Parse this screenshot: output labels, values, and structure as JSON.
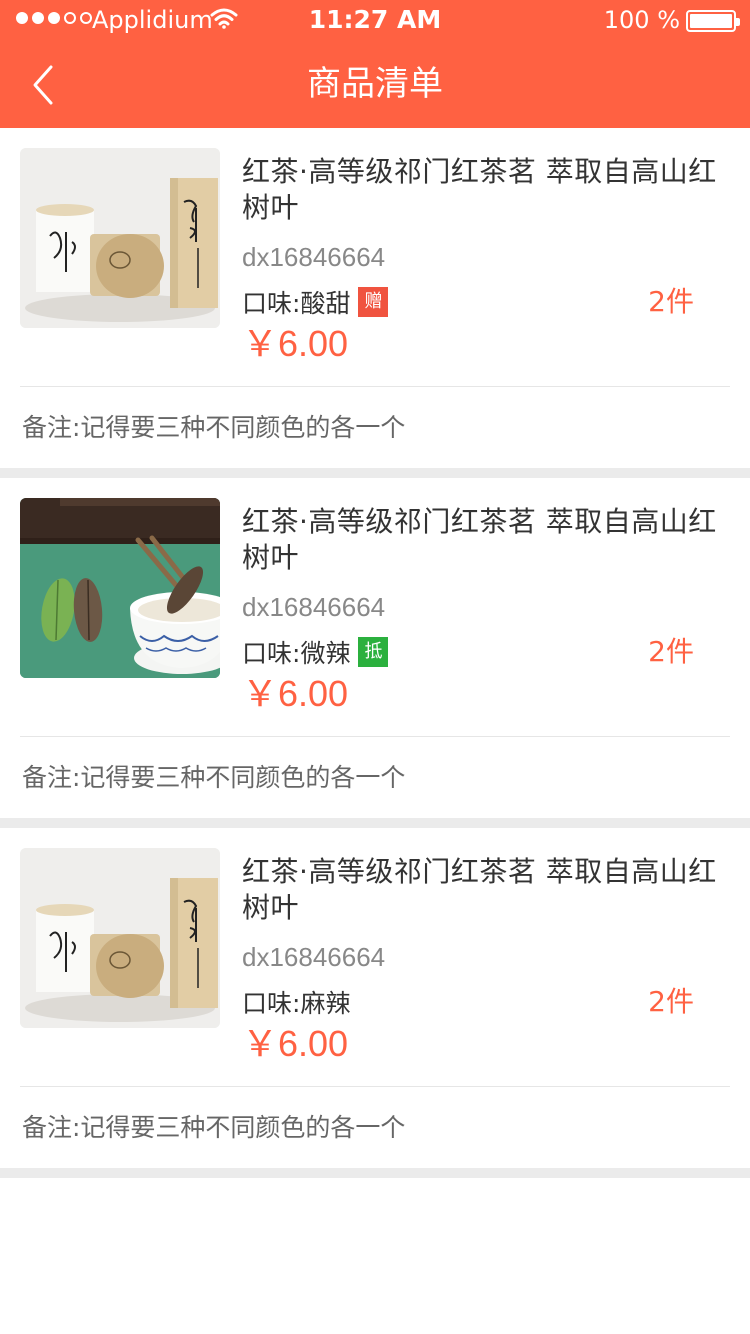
{
  "status_bar": {
    "carrier": "Applidium",
    "time": "11:27 AM",
    "battery": "100 %",
    "signal_strength": 3,
    "signal_total": 5,
    "battery_level": 1.0,
    "wifi_icon": "wifi-icon"
  },
  "nav": {
    "title": "商品清单",
    "back_icon": "chevron-left-icon"
  },
  "colors": {
    "accent": "#ff6142",
    "tag_gift": "#f0533f",
    "tag_credit": "#2bb03e"
  },
  "products": [
    {
      "title": "红茶·高等级祁门红茶茗  萃取自高山红树叶",
      "code": "dx16846664",
      "flavor_label": "口味:",
      "flavor_value": "酸甜",
      "tag": "赠",
      "tag_color": "#f0533f",
      "qty": "2件",
      "price": "￥6.00",
      "note": "备注:记得要三种不同颜色的各一个",
      "image": "tea-canisters"
    },
    {
      "title": "红茶·高等级祁门红茶茗  萃取自高山红树叶",
      "code": "dx16846664",
      "flavor_label": "口味:",
      "flavor_value": "微辣",
      "tag": "抵",
      "tag_color": "#2bb03e",
      "qty": "2件",
      "price": "￥6.00",
      "note": "备注:记得要三种不同颜色的各一个",
      "image": "tea-cup"
    },
    {
      "title": "红茶·高等级祁门红茶茗  萃取自高山红树叶",
      "code": "dx16846664",
      "flavor_label": "口味:",
      "flavor_value": "麻辣",
      "tag": "",
      "tag_color": "",
      "qty": "2件",
      "price": "￥6.00",
      "note": "备注:记得要三种不同颜色的各一个",
      "image": "tea-canisters"
    }
  ]
}
